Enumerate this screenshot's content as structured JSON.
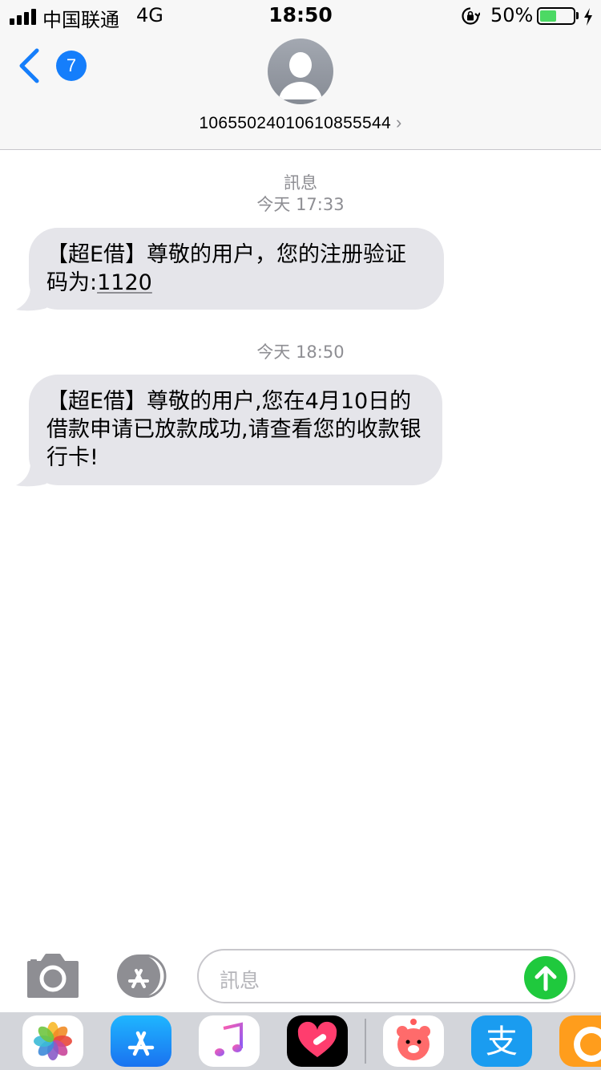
{
  "status_bar": {
    "carrier": "中国联通",
    "network": "4G",
    "time": "18:50",
    "battery_percent": "50%",
    "battery_level": 0.5,
    "battery_color": "#4cd964"
  },
  "nav": {
    "back_badge": "7",
    "back_icon": "chevron-left-icon",
    "contact_number": "10655024010610855544",
    "chevron": "›",
    "accent_color": "#157efb"
  },
  "conversation": {
    "service_label": "訊息",
    "messages": [
      {
        "timestamp": "今天 17:33",
        "text_before_code": "【超E借】尊敬的用户，您的注册验证码为:",
        "code": "1120"
      },
      {
        "timestamp": "今天 18:50",
        "text": "【超E借】尊敬的用户,您在4月10日的借款申请已放款成功,请查看您的收款银行卡!"
      }
    ]
  },
  "input_bar": {
    "placeholder": "訊息",
    "send_color": "#1fc93d"
  },
  "app_drawer": {
    "apps": [
      "photos-app-icon",
      "app-store-icon",
      "music-app-icon",
      "heart-sticker-app-icon",
      "bear-sticker-app-icon",
      "alipay-app-icon",
      "uc-browser-app-icon"
    ],
    "alipay_glyph": "支"
  }
}
